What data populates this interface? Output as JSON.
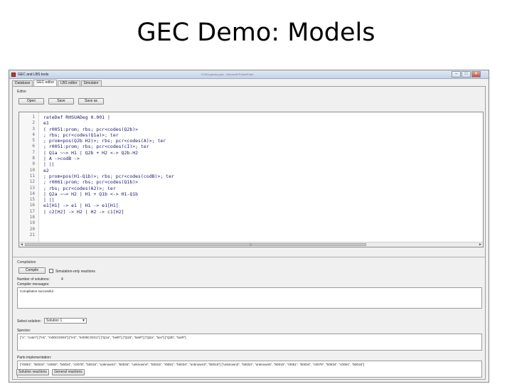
{
  "slide": {
    "title": "GEC Demo: Models"
  },
  "window": {
    "title": "GEC and LBS tools",
    "center_caption": "FOSA-gecdo.pptx - Microsoft PowerPoint",
    "controls": {
      "minimize": "–",
      "maximize": "□",
      "close": "✕"
    }
  },
  "tabs": [
    "Database",
    "GEC editor",
    "LBS editor",
    "Simulator"
  ],
  "editor_section": {
    "label": "Editor",
    "buttons": {
      "open": "Open",
      "save": "Save",
      "save_as": "Save as"
    },
    "line_numbers": [
      "1",
      "2",
      "3",
      "4",
      "5",
      "6",
      "7",
      "8",
      "9",
      "10",
      "11",
      "12",
      "13",
      "14",
      "15",
      "16",
      "17",
      "18",
      "19",
      "20",
      "21"
    ],
    "code_lines": [
      "rateDef RHSUADeg 0.001 |",
      "e1",
      "( r0051:prom; rbs; pcr<codes(Q2b)>",
      "; rbs; pcr<codes(Q1a)>; ter",
      "; prom<pos(Q2b H2)>; rbs; pcr<codes(A)>; ter",
      "; r0051:prom; rbs; pcr<codes(cI)>; ter",
      "| Q1a ~~> H1 | Q2b + H2 <-> Q2b-H2",
      "| A ->codB ->",
      "| ||",
      "e2",
      "; prom<pos(H1-Q1b)>; rbs; pcr<codes(codB)>; ter",
      "; r0061:prom; rbs; pcr<codes(Q1b)>",
      "; rbs; pcr<codes(A2)>; ter",
      "| Q2a ~~> H2 | H1 + Q1b <-> H1-Q1b",
      "| ||",
      "e1[H1] -> e1 | H1 -> e1[H1]",
      "| c2[H2] -> H2 | H2 -> c1[H2]"
    ],
    "scroll": {
      "left": "◄",
      "right": "►",
      "mid": "|||"
    }
  },
  "compilation_section": {
    "label": "Compilation",
    "compile_button": "Compile",
    "simulation_checkbox": "Simulation-only reactions",
    "num_solutions_label": "Number of solutions:",
    "num_solutions_value": "4",
    "messages_label": "Compiler messages:",
    "messages_value": "Compilation successful",
    "select_label": "Select solution:",
    "select_value": "Solution 1",
    "combo_arrow": "▼",
    "species_label": "Species:",
    "species_value": "[\"A\", \"codA\"] [\"H1\", \"m00CIGIE0\"] [\"H2\", \"m000CIOG1\"] [\"Q1a\", \"lasR\"] [\"Q1b\", \"lasR\"] [\"Q2a\", \"luxI\"] [\"Q2b\", \"luxR\"]",
    "parts_label": "Parts implementation:",
    "parts_value": "[\"r0051\", \"b0034\", \"c0062\", \"b0034\", \"c0078\", \"b0015\", \"unknown2\", \"b0034\", \"unknown4\", \"b0015\", \"r0051\", \"b0034\", \"unknown3\", \"b0015\"] [\"unknown2\", \"b0034\", \"unknown5\", \"b0015\", \"r0051\", \"b0034\", \"c0079\", \"b0034\", \"c0061\", \"b0015\"]",
    "bottom_buttons": {
      "solution": "Solution reactions",
      "general": "General reactions"
    }
  },
  "colors": {
    "code_text": "#1a1a6e",
    "title_bar": "#c4d3e6"
  }
}
